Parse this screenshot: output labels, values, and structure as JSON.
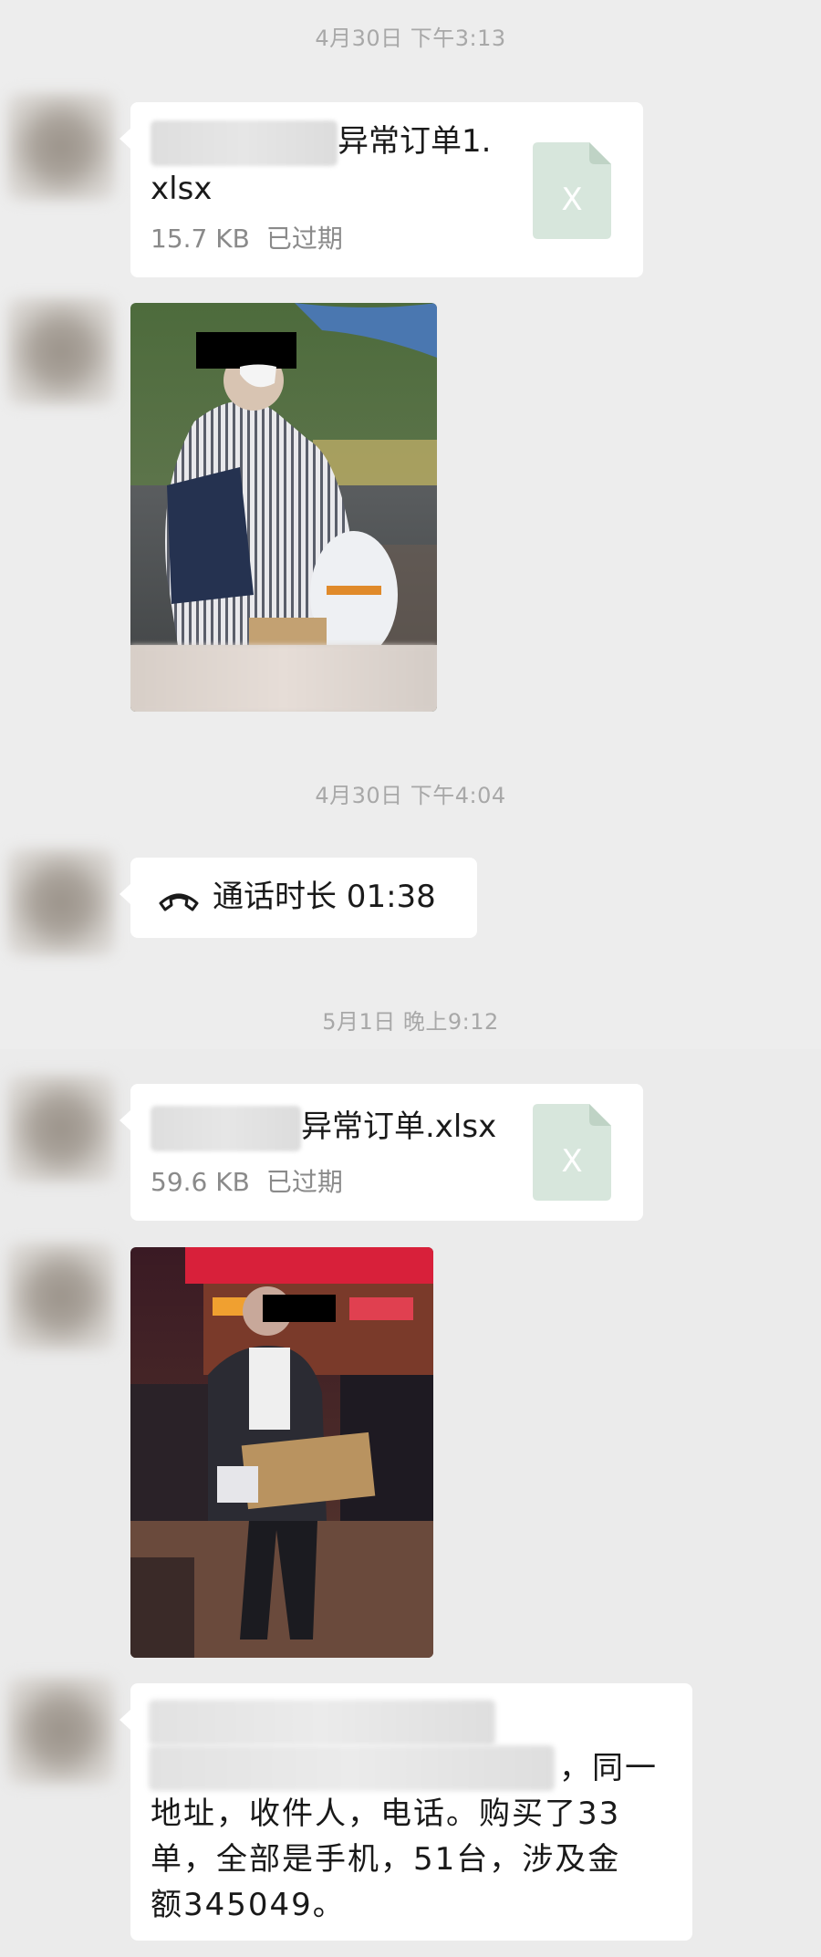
{
  "messages": {
    "ts1": "4月30日 下午3:13",
    "file1": {
      "name_line1": "异常订单1.",
      "name_line2": "xlsx",
      "size": "15.7 KB",
      "status": "已过期",
      "icon_letter": "X"
    },
    "ts2": "4月30日 下午4:04",
    "call": {
      "label": "通话时长 01:38"
    },
    "ts3": "5月1日 晚上9:12",
    "file2": {
      "name": "异常订单.xlsx",
      "size": "59.6 KB",
      "status": "已过期",
      "icon_letter": "X"
    },
    "text": {
      "line2_tail": "，同一",
      "line3": "地址，收件人，电话。购买了33",
      "line4": "单，全部是手机，51台，涉及金",
      "line5": "额345049。"
    }
  },
  "colors": {
    "bubble": "#ffffff",
    "background": "#ededed",
    "excel_icon": "#d7e6dc",
    "timestamp": "#a8a8a8"
  },
  "icons": {
    "file": "excel-file-icon",
    "call": "phone-hangup-icon"
  }
}
